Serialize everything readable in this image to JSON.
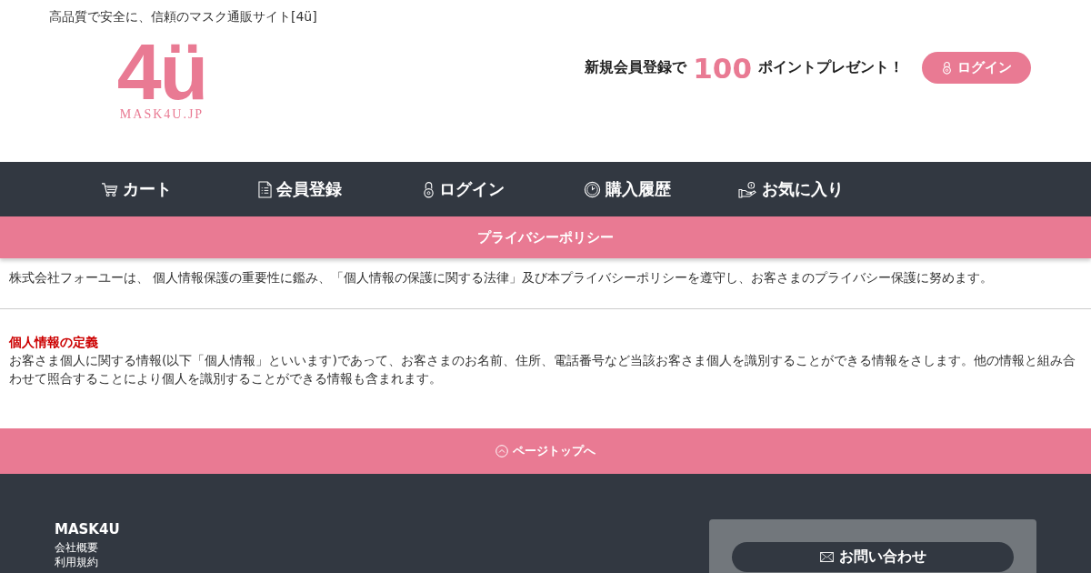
{
  "header": {
    "tagline": "高品質で安全に、信頼のマスク通販サイト[4ü]",
    "logo": {
      "mark": "4ü",
      "wordmark": "MASK4U.JP"
    },
    "promo": {
      "before": "新規会員登録で",
      "points": "100",
      "after": "ポイントプレゼント！"
    },
    "login_button": "ログイン"
  },
  "nav": [
    {
      "label": "カート"
    },
    {
      "label": "会員登録"
    },
    {
      "label": "ログイン"
    },
    {
      "label": "購入履歴"
    },
    {
      "label": "お気に入り"
    }
  ],
  "page_title": "プライバシーポリシー",
  "intro": "株式会社フォーユーは、 個人情報保護の重要性に鑑み、「個人情報の保護に関する法律」及び本プライバシーポリシーを遵守し、お客さまのプライバシー保護に努めます。",
  "sections": [
    {
      "heading": "個人情報の定義",
      "body": "お客さま個人に関する情報(以下「個人情報」といいます)であって、お客さまのお名前、住所、電話番号など当該お客さま個人を識別することができる情報をさします。他の情報と組み合わせて照合することにより個人を識別することができる情報も含まれます。"
    }
  ],
  "page_top": "ページトップへ",
  "footer": {
    "brand": "MASK4U",
    "links": [
      "会社概要",
      "利用規約"
    ],
    "contact_button": "お問い合わせ"
  }
}
